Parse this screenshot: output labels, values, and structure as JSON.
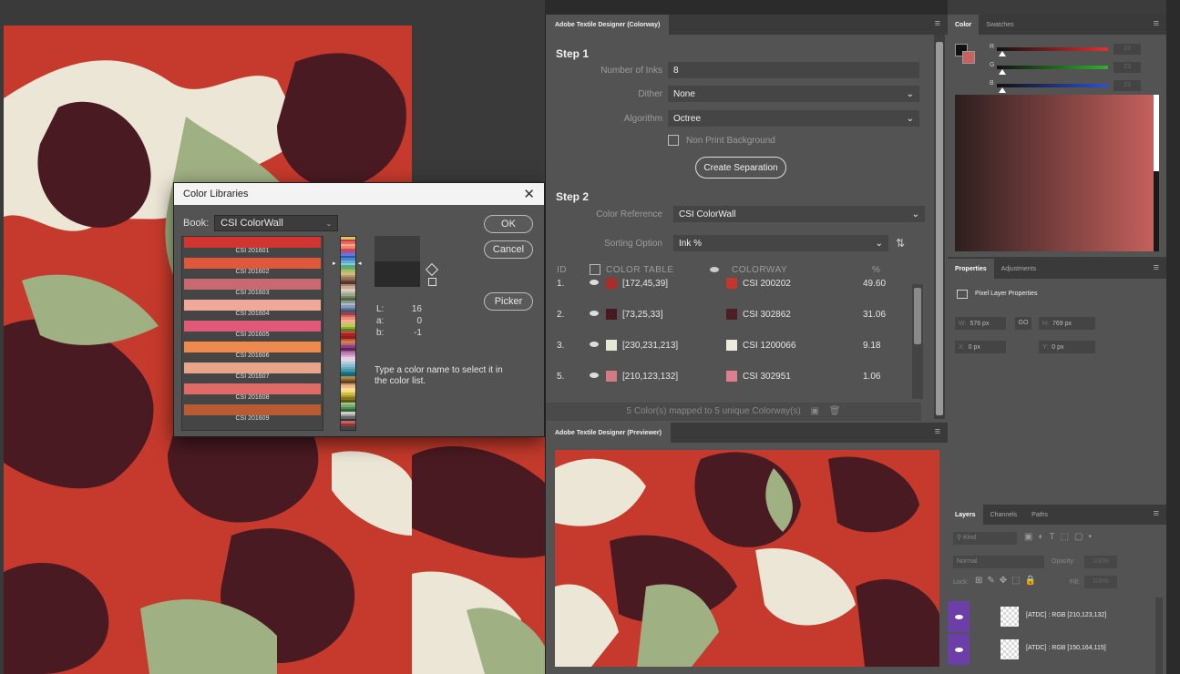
{
  "color_libraries": {
    "title": "Color Libraries",
    "close_glyph": "✕",
    "book_label": "Book:",
    "book_value": "CSI ColorWall",
    "ok_label": "OK",
    "cancel_label": "Cancel",
    "picker_label": "Picker",
    "swatches": [
      {
        "name": "CSI 201601",
        "color": "#d0352f"
      },
      {
        "name": "CSI 201602",
        "color": "#e0573a"
      },
      {
        "name": "CSI 201603",
        "color": "#c66a70"
      },
      {
        "name": "CSI 201604",
        "color": "#f0a89a"
      },
      {
        "name": "CSI 201605",
        "color": "#e05a78"
      },
      {
        "name": "CSI 201606",
        "color": "#ee8a4e"
      },
      {
        "name": "CSI 201607",
        "color": "#e9a58a"
      },
      {
        "name": "CSI 201608",
        "color": "#e06a66"
      },
      {
        "name": "CSI 201609",
        "color": "#b85a32"
      }
    ],
    "lab": {
      "L_label": "L:",
      "L": "16",
      "a_label": "a:",
      "a": "0",
      "b_label": "b:",
      "b": "-1"
    },
    "hint": "Type a color name to select it in the color list."
  },
  "textile": {
    "tab": "Adobe Textile Designer (Colorway)",
    "step1": "Step 1",
    "inks_label": "Number of Inks",
    "inks_value": "8",
    "dither_label": "Dither",
    "dither_value": "None",
    "algorithm_label": "Algorithm",
    "algorithm_value": "Octree",
    "nonprint_label": "Non Print Background",
    "create_sep": "Create Separation",
    "step2": "Step 2",
    "colorref_label": "Color Reference",
    "colorref_value": "CSI ColorWall",
    "sorting_label": "Sorting Option",
    "sorting_value": "Ink %",
    "headers": {
      "id": "ID",
      "color_table": "COLOR TABLE",
      "colorway": "COLORWAY",
      "pct": "%"
    },
    "rows": [
      {
        "id": "1.",
        "rgb": "[172,45,39]",
        "rgb_color": "#ac2d27",
        "cw": "CSI 200202",
        "cw_color": "#c2362e",
        "pct": "49.60"
      },
      {
        "id": "2.",
        "rgb": "[73,25,33]",
        "rgb_color": "#491921",
        "cw": "CSI 302862",
        "cw_color": "#4d1e25",
        "pct": "31.06"
      },
      {
        "id": "3.",
        "rgb": "[230,231,213]",
        "rgb_color": "#e6e7d5",
        "cw": "CSI 1200066",
        "cw_color": "#eeeadf",
        "pct": "9.18"
      },
      {
        "id": "5.",
        "rgb": "[210,123,132]",
        "rgb_color": "#d27b84",
        "cw": "CSI 302951",
        "cw_color": "#e07e91",
        "pct": "1.06"
      }
    ],
    "footer": "5 Color(s) mapped to 5 unique Colorway(s)"
  },
  "previewer": {
    "tab": "Adobe Textile Designer (Previewer)"
  },
  "color_panel": {
    "tabs": [
      "Color",
      "Swatches"
    ],
    "r_label": "R",
    "g_label": "G",
    "b_label": "B",
    "r_value": "23",
    "g_value": "23",
    "b_value": "23"
  },
  "properties_panel": {
    "tabs": [
      "Properties",
      "Adjustments"
    ],
    "heading": "Pixel Layer Properties",
    "w_label": "W:",
    "w_value": "576 px",
    "h_label": "H:",
    "h_value": "769 px",
    "x_label": "X:",
    "x_value": "0 px",
    "y_label": "Y:",
    "y_value": "0 px",
    "link_glyph": "GO"
  },
  "layers_panel": {
    "tabs": [
      "Layers",
      "Channels",
      "Paths"
    ],
    "kind_placeholder": "Kind",
    "blend_mode": "Normal",
    "opacity_label": "Opacity:",
    "opacity_value": "100%",
    "lock_label": "Lock:",
    "fill_label": "Fill:",
    "fill_value": "100%",
    "layers": [
      {
        "name": "[ATDC] : RGB [210,123,132]"
      },
      {
        "name": "[ATDC] : RGB [150,164,115]"
      }
    ]
  }
}
